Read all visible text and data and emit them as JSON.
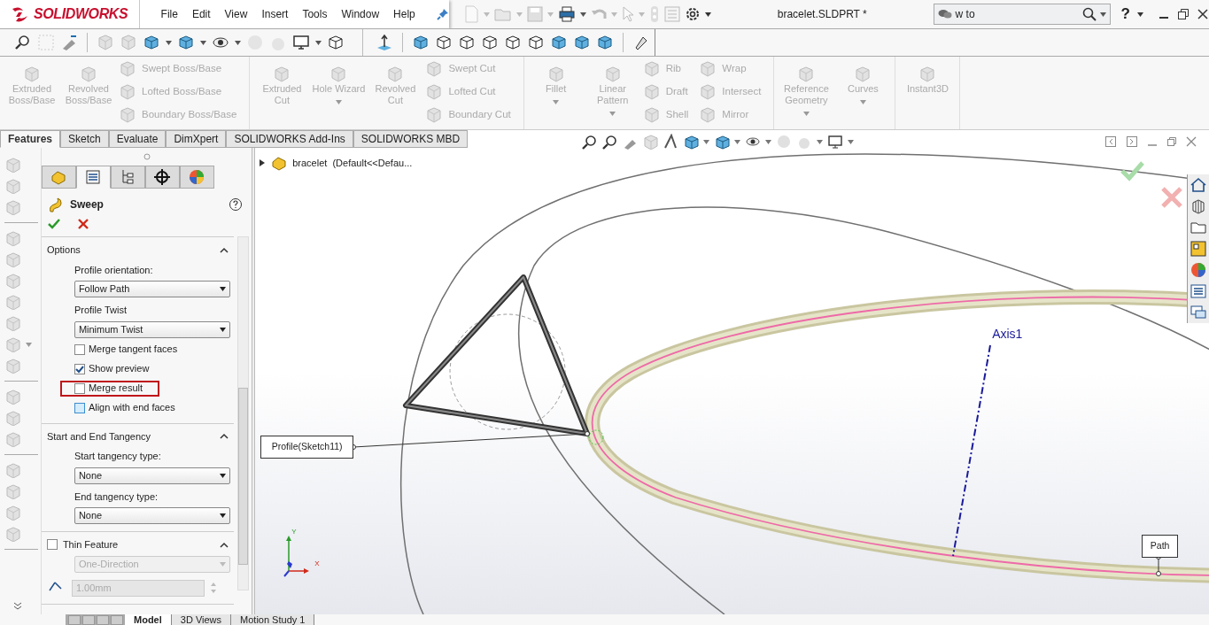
{
  "logo": {
    "text": "SOLIDWORKS"
  },
  "menu": [
    {
      "label": "File"
    },
    {
      "label": "Edit"
    },
    {
      "label": "View"
    },
    {
      "label": "Insert"
    },
    {
      "label": "Tools"
    },
    {
      "label": "Window"
    },
    {
      "label": "Help"
    }
  ],
  "document_title": "bracelet.SLDPRT *",
  "search": {
    "value": "w to"
  },
  "help_button": "?",
  "ribbon": {
    "groups": [
      {
        "large": [
          {
            "label": "Extruded Boss/Base",
            "disabled": true,
            "dropdown": false
          },
          {
            "label": "Revolved Boss/Base",
            "disabled": true,
            "dropdown": false
          }
        ],
        "small_columns": [
          [
            {
              "label": "Swept Boss/Base",
              "disabled": true
            },
            {
              "label": "Lofted Boss/Base",
              "disabled": true
            },
            {
              "label": "Boundary Boss/Base",
              "disabled": true
            }
          ]
        ]
      },
      {
        "large": [
          {
            "label": "Extruded Cut",
            "disabled": true,
            "dropdown": false
          },
          {
            "label": "Hole Wizard",
            "disabled": true,
            "dropdown": true
          },
          {
            "label": "Revolved Cut",
            "disabled": true,
            "dropdown": false
          }
        ],
        "small_columns": [
          [
            {
              "label": "Swept Cut",
              "disabled": true
            },
            {
              "label": "Lofted Cut",
              "disabled": true
            },
            {
              "label": "Boundary Cut",
              "disabled": true
            }
          ]
        ]
      },
      {
        "large": [
          {
            "label": "Fillet",
            "disabled": true,
            "dropdown": true
          },
          {
            "label": "Linear Pattern",
            "disabled": true,
            "dropdown": true
          }
        ],
        "small_columns": [
          [
            {
              "label": "Rib",
              "disabled": true
            },
            {
              "label": "Draft",
              "disabled": true
            },
            {
              "label": "Shell",
              "disabled": true
            }
          ],
          [
            {
              "label": "Wrap",
              "disabled": true
            },
            {
              "label": "Intersect",
              "disabled": true
            },
            {
              "label": "Mirror",
              "disabled": true
            }
          ]
        ]
      },
      {
        "large": [
          {
            "label": "Reference Geometry",
            "disabled": true,
            "dropdown": true
          },
          {
            "label": "Curves",
            "disabled": true,
            "dropdown": true
          }
        ]
      },
      {
        "large": [
          {
            "label": "Instant3D",
            "disabled": true,
            "dropdown": false
          }
        ]
      }
    ]
  },
  "command_tabs": [
    {
      "label": "Features",
      "selected": true
    },
    {
      "label": "Sketch",
      "selected": false
    },
    {
      "label": "Evaluate",
      "selected": false
    },
    {
      "label": "DimXpert",
      "selected": false
    },
    {
      "label": "SOLIDWORKS Add-Ins",
      "selected": false
    },
    {
      "label": "SOLIDWORKS MBD",
      "selected": false
    }
  ],
  "property_manager": {
    "tabs": [
      {
        "selected": false
      },
      {
        "selected": true
      },
      {
        "selected": false
      },
      {
        "selected": false
      },
      {
        "selected": false
      }
    ],
    "title": "Sweep",
    "sections": [
      {
        "title": "Options",
        "expanded": true,
        "controls": [
          {
            "kind": "label",
            "text": "Profile orientation:"
          },
          {
            "kind": "select",
            "value": "Follow Path",
            "disabled": false
          },
          {
            "kind": "label",
            "text": "Profile Twist"
          },
          {
            "kind": "select",
            "value": "Minimum Twist",
            "disabled": false
          },
          {
            "kind": "checkbox",
            "label": "Merge tangent faces",
            "checked": false,
            "highlighted": false,
            "hovered": false
          },
          {
            "kind": "checkbox",
            "label": "Show preview",
            "checked": true,
            "highlighted": false,
            "hovered": false
          },
          {
            "kind": "checkbox",
            "label": "Merge result",
            "checked": false,
            "highlighted": true,
            "hovered": false
          },
          {
            "kind": "checkbox",
            "label": "Align with end faces",
            "checked": false,
            "highlighted": false,
            "hovered": true
          }
        ]
      },
      {
        "title": "Start and End Tangency",
        "expanded": true,
        "controls": [
          {
            "kind": "label",
            "text": "Start tangency type:"
          },
          {
            "kind": "select",
            "value": "None",
            "disabled": false
          },
          {
            "kind": "label",
            "text": "End tangency type:"
          },
          {
            "kind": "select",
            "value": "None",
            "disabled": false
          }
        ]
      },
      {
        "title": "Thin Feature",
        "expanded": true,
        "checked": false,
        "controls": [
          {
            "kind": "select",
            "value": "One-Direction",
            "disabled": true
          },
          {
            "kind": "spin",
            "value": "1.00mm",
            "disabled": true
          }
        ]
      }
    ]
  },
  "feature_tree": {
    "items": [
      {
        "label": "bracelet  (Default<<Defau...",
        "expanded": false
      }
    ]
  },
  "viewport": {
    "callouts": [
      {
        "text": "Profile(Sketch11)"
      },
      {
        "text": "Path"
      }
    ],
    "axis_label": "Axis1",
    "triad_labels": [
      "Y",
      "X"
    ]
  },
  "bottom_tabs": [
    {
      "label": "Model",
      "selected": true
    },
    {
      "label": "3D Views",
      "selected": false
    },
    {
      "label": "Motion Study 1",
      "selected": false
    }
  ]
}
